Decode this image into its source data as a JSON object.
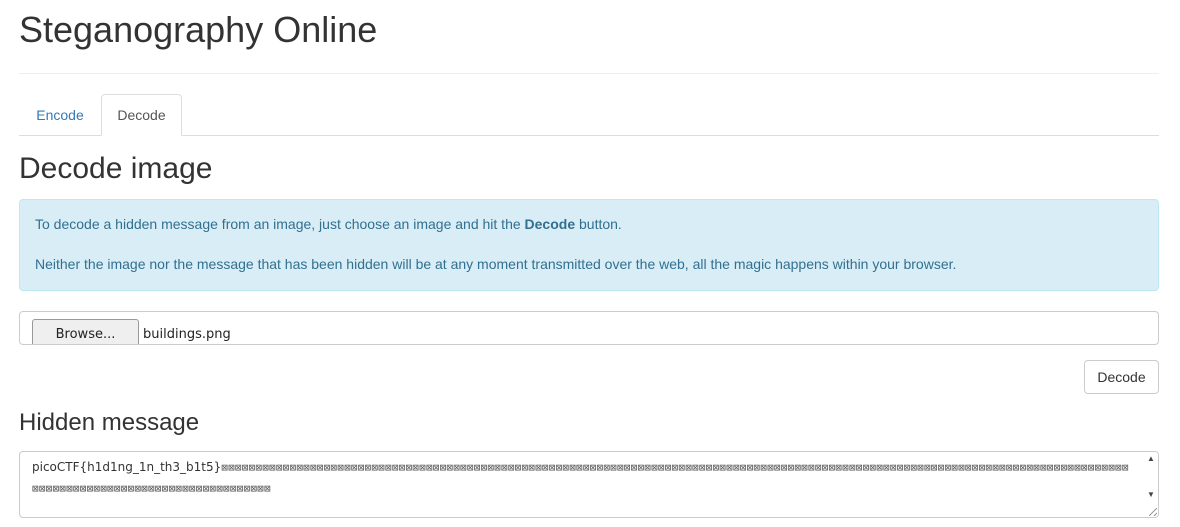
{
  "header": {
    "title": "Steganography Online"
  },
  "tabs": [
    {
      "label": "Encode",
      "active": false
    },
    {
      "label": "Decode",
      "active": true
    }
  ],
  "main": {
    "section_title": "Decode image",
    "info": {
      "line1_prefix": "To decode a hidden message from an image, just choose an image and hit the ",
      "line1_bold": "Decode",
      "line1_suffix": " button.",
      "line2": "Neither the image nor the message that has been hidden will be at any moment transmitted over the web, all the magic happens within your browser."
    },
    "file_input": {
      "button_label": "Browse...",
      "file_name": "buildings.png"
    },
    "decode_button": "Decode",
    "hidden_message_title": "Hidden message",
    "hidden_message": {
      "text": "picoCTF{h1d1ng_1n_th3_b1t5}",
      "trailing_glyphs": "⊠⊠⊠⊠⊠⊠⊠⊠⊠⊠⊠⊠⊠⊠⊠⊠⊠⊠⊠⊠⊠⊠⊠⊠⊠⊠⊠⊠⊠⊠⊠⊠⊠⊠⊠⊠⊠⊠⊠⊠⊠⊠⊠⊠⊠⊠⊠⊠⊠⊠⊠⊠⊠⊠⊠⊠⊠⊠⊠⊠⊠⊠⊠⊠⊠⊠⊠⊠⊠⊠⊠⊠⊠⊠⊠⊠⊠⊠⊠⊠⊠⊠⊠⊠⊠⊠⊠⊠⊠⊠⊠⊠⊠⊠⊠⊠⊠⊠⊠⊠⊠⊠⊠⊠⊠⊠⊠⊠⊠⊠⊠⊠⊠⊠⊠⊠⊠⊠⊠⊠⊠⊠⊠⊠⊠⊠⊠⊠⊠⊠⊠⊠⊠⊠⊠⊠⊠⊠⊠⊠⊠⊠⊠⊠⊠⊠⊠⊠⊠⊠⊠⊠⊠⊠⊠⊠⊠⊠⊠⊠⊠⊠⊠⊠⊠⊠⊠⊠"
    }
  },
  "colors": {
    "link": "#337ab7",
    "alert_bg": "#d9edf7",
    "alert_text": "#31708f",
    "alert_border": "#bce8f1"
  },
  "icons": {
    "scroll_up": "scroll-up-arrow-icon",
    "scroll_down": "scroll-down-arrow-icon",
    "resize": "resize-grip-icon"
  }
}
